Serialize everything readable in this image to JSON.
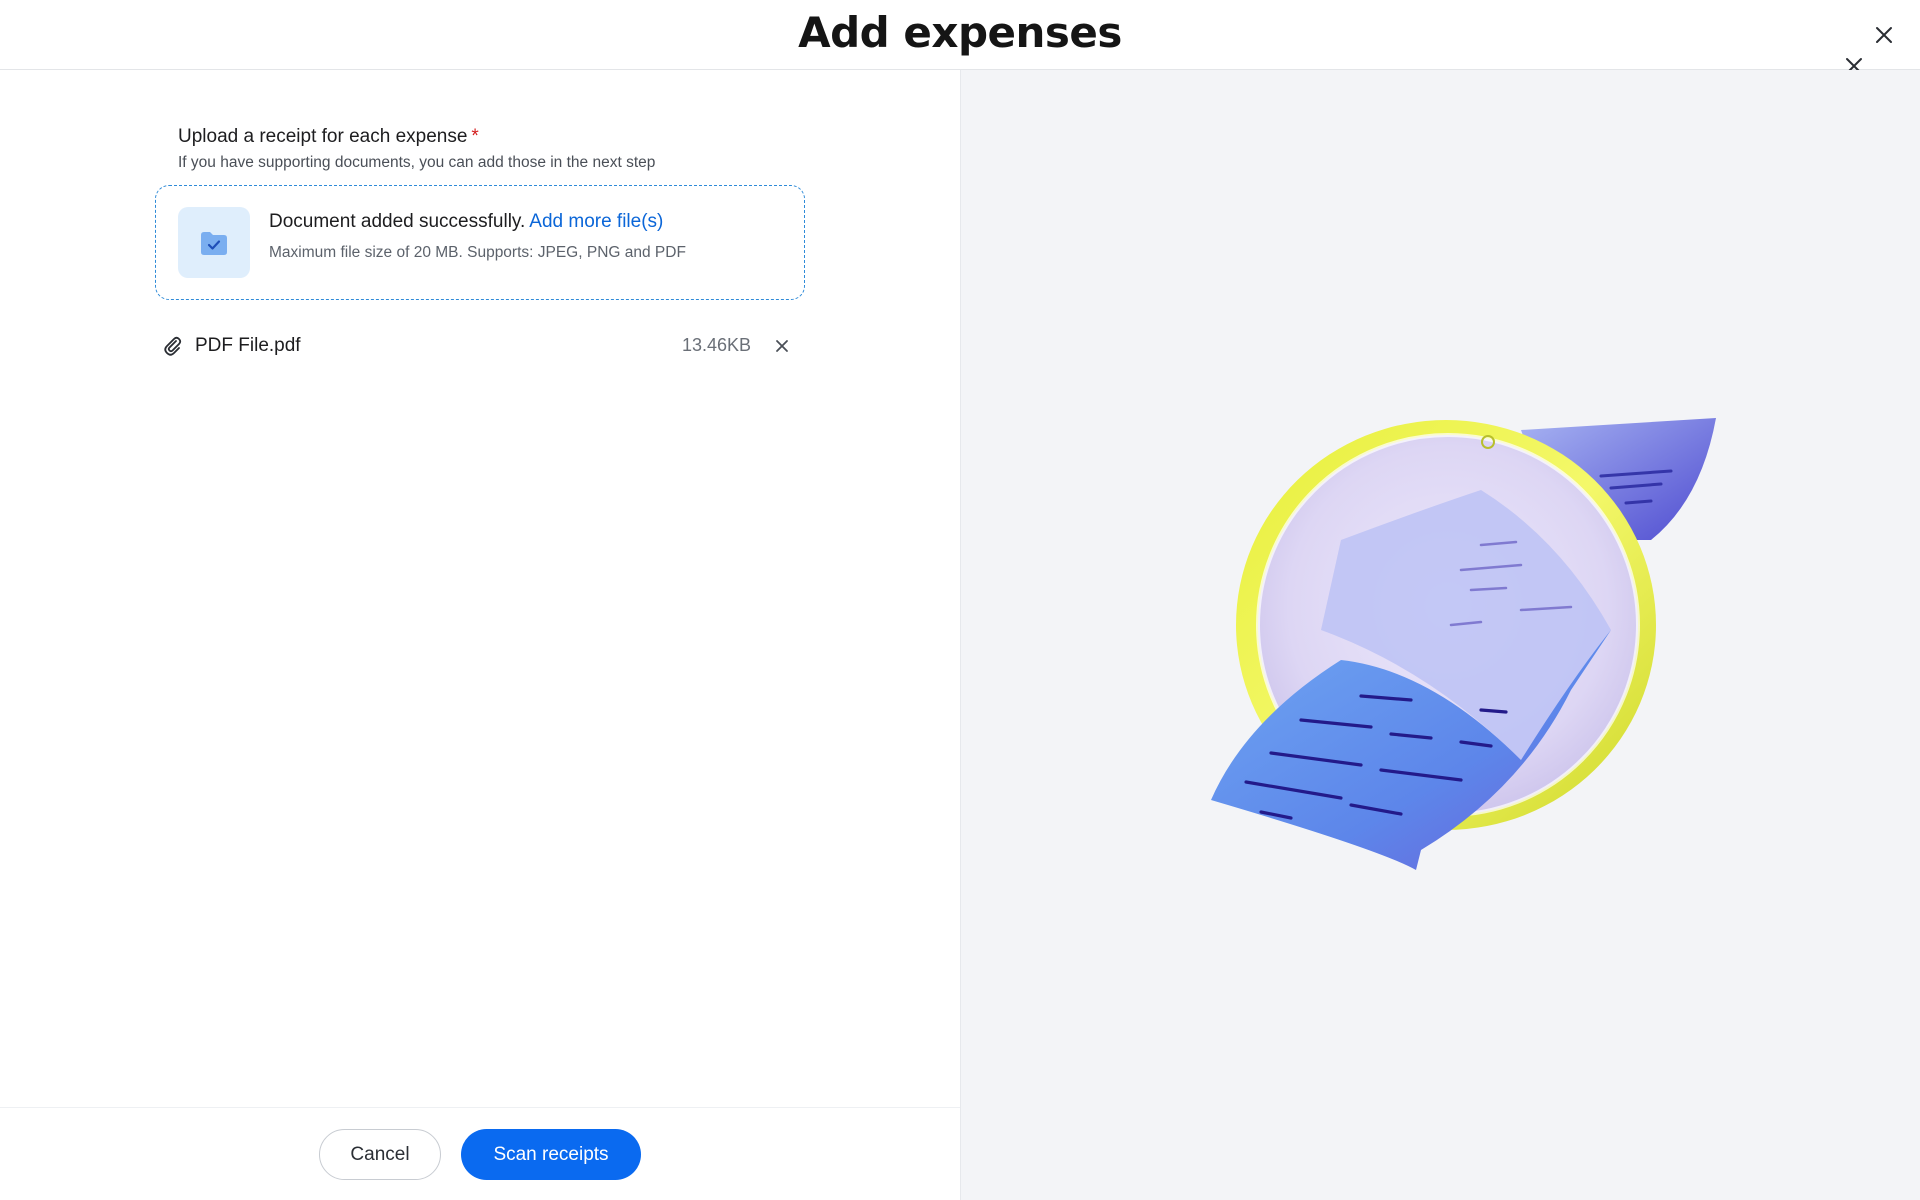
{
  "header": {
    "title": "Add expenses"
  },
  "upload": {
    "label": "Upload a receipt for each expense",
    "required_mark": "*",
    "help": "If you have supporting documents, you can add those in the next step"
  },
  "dropzone": {
    "success_text": "Document added successfully.",
    "add_more_link": "Add more file(s)",
    "limits": "Maximum file size of 20 MB. Supports: JPEG, PNG and PDF",
    "icon": "folder-check-icon"
  },
  "files": [
    {
      "name": "PDF File.pdf",
      "size": "13.46KB"
    }
  ],
  "footer": {
    "cancel_label": "Cancel",
    "primary_label": "Scan receipts"
  },
  "colors": {
    "accent": "#0a6af0",
    "link": "#0b66d8",
    "required": "#d31e1e",
    "dropzone_border": "#2f8bd8",
    "right_panel_bg": "#f3f4f7"
  }
}
